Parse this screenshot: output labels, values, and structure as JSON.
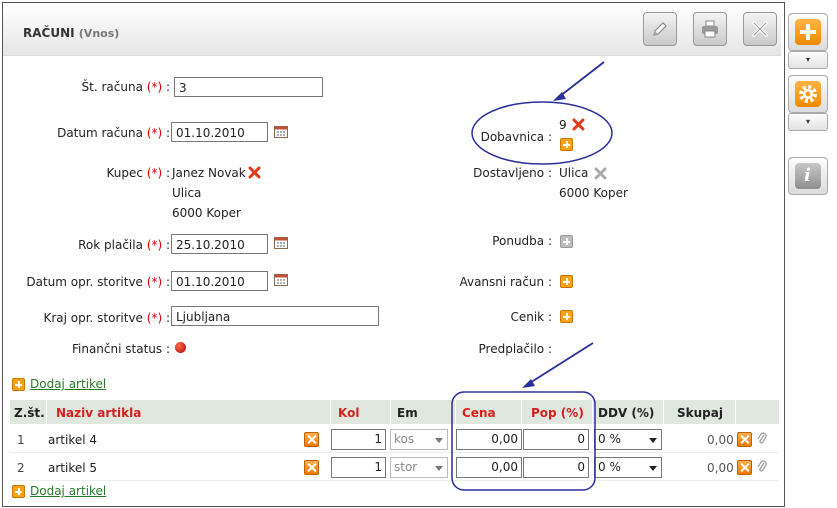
{
  "header": {
    "title": "RAČUNI",
    "subtitle": "(Vnos)",
    "edit_icon": "pencil-icon",
    "print_icon": "printer-icon",
    "close_icon": "close-icon"
  },
  "side_toolbar": {
    "add_icon": "plus-icon",
    "settings_icon": "gear-icon",
    "info_icon": "info-icon",
    "dropdown_glyph": "▾"
  },
  "form": {
    "required_marker": "(*)",
    "invoice_number": {
      "label": "Št. računa",
      "value": "3"
    },
    "invoice_date": {
      "label": "Datum računa",
      "value": "01.10.2010"
    },
    "buyer": {
      "label": "Kupec",
      "name": "Janez Novak",
      "street": "Ulica",
      "city": "6000 Koper"
    },
    "due_date": {
      "label": "Rok plačila",
      "value": "25.10.2010"
    },
    "service_date": {
      "label": "Datum opr. storitve",
      "value": "01.10.2010"
    },
    "service_place": {
      "label": "Kraj opr. storitve",
      "value": "Ljubljana"
    },
    "financial_status": {
      "label": "Finančni status :"
    },
    "delivery_note": {
      "label": "Dobavnica :",
      "value": "9"
    },
    "delivered": {
      "label": "Dostavljeno :",
      "street": "Ulica",
      "city": "6000 Koper"
    },
    "offer": {
      "label": "Ponudba :"
    },
    "advance_invoice": {
      "label": "Avansni račun :"
    },
    "price_list": {
      "label": "Cenik :"
    },
    "prepaid": {
      "label": "Predplačilo :"
    }
  },
  "add_article_top": "Dodaj artikel",
  "add_article_bottom": "Dodaj artikel",
  "table": {
    "headers": {
      "num": "Z.št.",
      "name": "Naziv artikla",
      "qty": "Kol",
      "unit": "Em",
      "price": "Cena",
      "discount": "Pop (%)",
      "vat": "DDV (%)",
      "total": "Skupaj"
    },
    "rows": [
      {
        "num": "1",
        "name": "artikel 4",
        "qty": "1",
        "unit": "kos",
        "price": "0,00",
        "discount": "0",
        "vat": "0 %",
        "total": "0,00"
      },
      {
        "num": "2",
        "name": "artikel 5",
        "qty": "1",
        "unit": "stor",
        "price": "0,00",
        "discount": "0",
        "vat": "0 %",
        "total": "0,00"
      }
    ]
  },
  "colors": {
    "accent_orange": "#f7a21a",
    "required_red": "#d00000",
    "link_green": "#2a7a2a",
    "annotation_blue": "#2b2f9a",
    "table_header_bg": "#dfe7df"
  }
}
